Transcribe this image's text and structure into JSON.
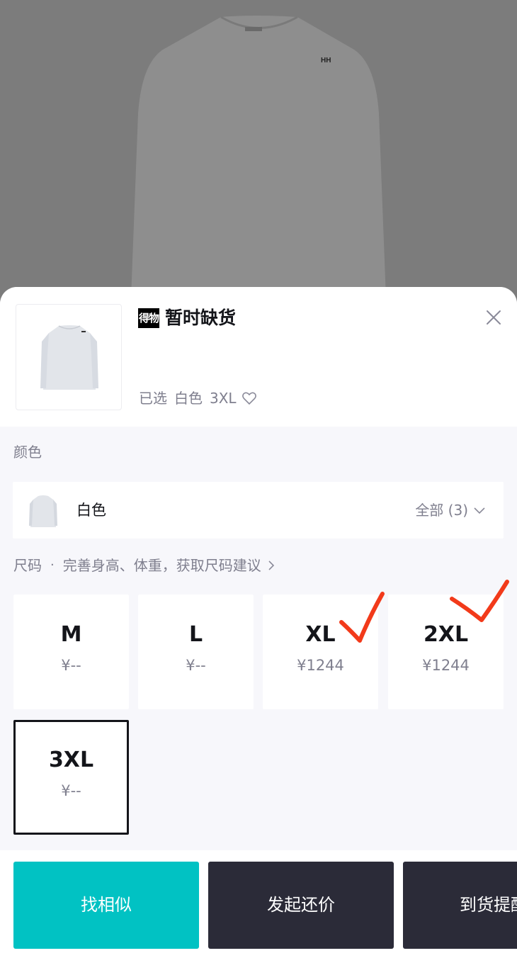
{
  "header": {
    "brand_logo_text": "得物",
    "stock_status": "暂时缺货",
    "selected_prefix": "已选",
    "selected_color": "白色",
    "selected_size": "3XL"
  },
  "color_section": {
    "label": "颜色",
    "current_color": "白色",
    "all_label": "全部 (3)"
  },
  "size_section": {
    "label": "尺码",
    "hint": "完善身高、体重，获取尺码建议",
    "sizes": [
      {
        "size": "M",
        "price": "¥--"
      },
      {
        "size": "L",
        "price": "¥--"
      },
      {
        "size": "XL",
        "price": "¥1244"
      },
      {
        "size": "2XL",
        "price": "¥1244"
      },
      {
        "size": "3XL",
        "price": "¥--"
      }
    ],
    "selected_size": "3XL"
  },
  "footer": {
    "buttons": [
      {
        "label": "找相似"
      },
      {
        "label": "发起还价"
      },
      {
        "label": "到货提醒"
      }
    ]
  },
  "colors": {
    "accent": "#01c2c3",
    "dark_button": "#2b2b38",
    "annotation_red": "#f23a1a",
    "text_primary": "#14151a",
    "text_secondary": "#7f7f8e"
  },
  "icons": {
    "close": "close-icon",
    "heart": "heart-icon",
    "chevron_down": "chevron-down-icon",
    "chevron_right": "chevron-right-icon"
  }
}
